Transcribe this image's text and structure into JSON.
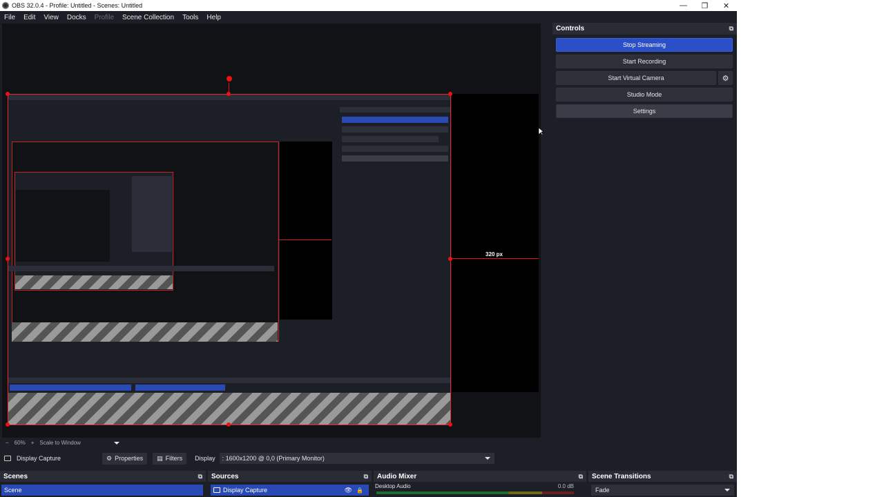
{
  "window": {
    "title": "OBS 32.0.4 - Profile: Untitled - Scenes: Untitled",
    "controls": {
      "minimize": "—",
      "restore": "❐",
      "close": "✕"
    }
  },
  "menu": [
    "File",
    "Edit",
    "View",
    "Docks",
    "Profile",
    "Scene Collection",
    "Tools",
    "Help"
  ],
  "preview": {
    "guide_label": "320 px"
  },
  "zoom": {
    "minus": "−",
    "level": "60%",
    "plus": "+",
    "mode": "Scale to Window"
  },
  "controls_dock": {
    "title": "Controls",
    "stop_streaming": "Stop Streaming",
    "start_recording": "Start Recording",
    "start_virtual_camera": "Start Virtual Camera",
    "studio_mode": "Studio Mode",
    "settings": "Settings"
  },
  "source_toolbar": {
    "source_name": "Display Capture",
    "properties": "Properties",
    "filters": "Filters",
    "display_label": "Display",
    "display_value": ": 1600x1200 @ 0,0 (Primary Monitor)"
  },
  "scenes": {
    "title": "Scenes",
    "items": [
      "Scene"
    ]
  },
  "sources": {
    "title": "Sources",
    "items": [
      "Display Capture"
    ]
  },
  "audio_mixer": {
    "title": "Audio Mixer",
    "channel": "Desktop Audio",
    "level": "0.0 dB"
  },
  "transitions": {
    "title": "Scene Transitions",
    "selected": "Fade"
  },
  "colors": {
    "accent": "#2b4fc6",
    "panel": "#1d1f26",
    "handle": "#e11111"
  }
}
